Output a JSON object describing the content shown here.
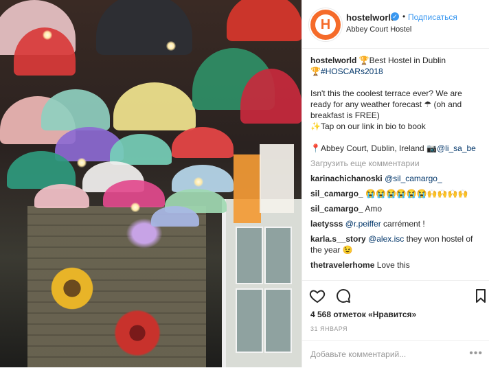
{
  "post": {
    "username": "hostelworld",
    "follow_label": "Подписаться",
    "location": "Abbey Court Hostel",
    "avatar_letter": "H",
    "verified_icon": "verified-badge-icon",
    "accent": "#3897f0",
    "brand": "#f56b2a"
  },
  "caption": {
    "user": "hostelworld",
    "line1": "🏆Best Hostel in Dublin",
    "line2_prefix": "🏆",
    "hashtag": "#HOSCARs2018",
    "body": "Isn't this the coolest terrace ever? We are ready for any weather forecast ☂ (oh and breakfast is FREE)",
    "cta": "✨Tap on our link in bio to book",
    "place_prefix": "📍Abbey Court, Dublin, Ireland 📷",
    "place_mention": "@li_sa_be"
  },
  "load_more": "Загрузить еще комментарии",
  "comments": [
    {
      "user": "karinachichanoski",
      "mention": "@sil_camargo_",
      "text": ""
    },
    {
      "user": "sil_camargo_",
      "mention": "",
      "text": "😭😭😭😭😭😭🙌🙌🙌🙌"
    },
    {
      "user": "sil_camargo_",
      "mention": "",
      "text": "Amo"
    },
    {
      "user": "laetysss",
      "mention": "@r.peiffer",
      "text": "carrément !"
    },
    {
      "user": "karla.s__story",
      "mention": "@alex.isc",
      "text": "they won hostel of the year 😉"
    },
    {
      "user": "thetravelerhome",
      "mention": "",
      "text": "Love this"
    }
  ],
  "actions": {
    "like_icon": "heart-icon",
    "comment_icon": "comment-icon",
    "save_icon": "bookmark-icon"
  },
  "likes": "4 568 отметок «Нравится»",
  "date": "31 ЯНВАРЯ",
  "add_comment_placeholder": "Добавьте комментарий...",
  "more_icon": "more-options-icon",
  "more_glyph": "•••"
}
